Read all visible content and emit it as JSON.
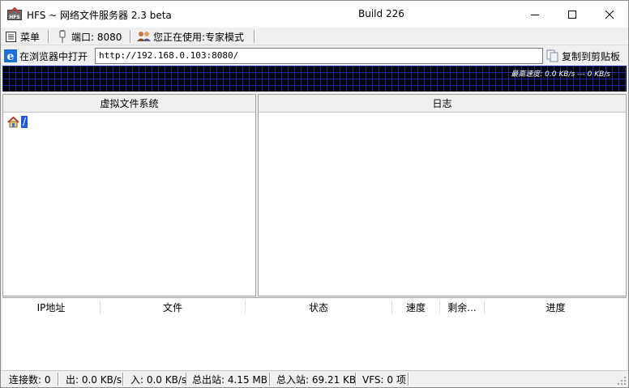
{
  "window": {
    "title": "HFS ~ 网络文件服务器 2.3 beta",
    "build": "Build 226"
  },
  "toolbar": {
    "menu_label": "菜单",
    "port_label": "端口: 8080",
    "mode_label": "您正在使用:专家模式"
  },
  "url_bar": {
    "open_in_browser_label": "在浏览器中打开",
    "url_value": "http://192.168.0.103:8080/",
    "copy_label": "复制到剪贴板"
  },
  "graph": {
    "speed_label": "最高速度: 0.0 KB/s --- 0 KB/s"
  },
  "vfs_panel": {
    "header": "虚拟文件系统",
    "root_item": "/"
  },
  "log_panel": {
    "header": "日志"
  },
  "transfers": {
    "columns": [
      "IP地址",
      "文件",
      "状态",
      "速度",
      "剩余...",
      "进度"
    ]
  },
  "status_bar": {
    "connections": "连接数: 0",
    "out_speed": "出: 0.0 KB/s",
    "in_speed": "入: 0.0 KB/s",
    "total_out": "总出站: 4.15 MB",
    "total_in": "总入站: 69.21 KB",
    "vfs_items": "VFS: 0 项"
  },
  "colors": {
    "graph_bg": "#000000",
    "graph_grid": "#1a2ea0",
    "selected_root": "#1e5bd6"
  }
}
